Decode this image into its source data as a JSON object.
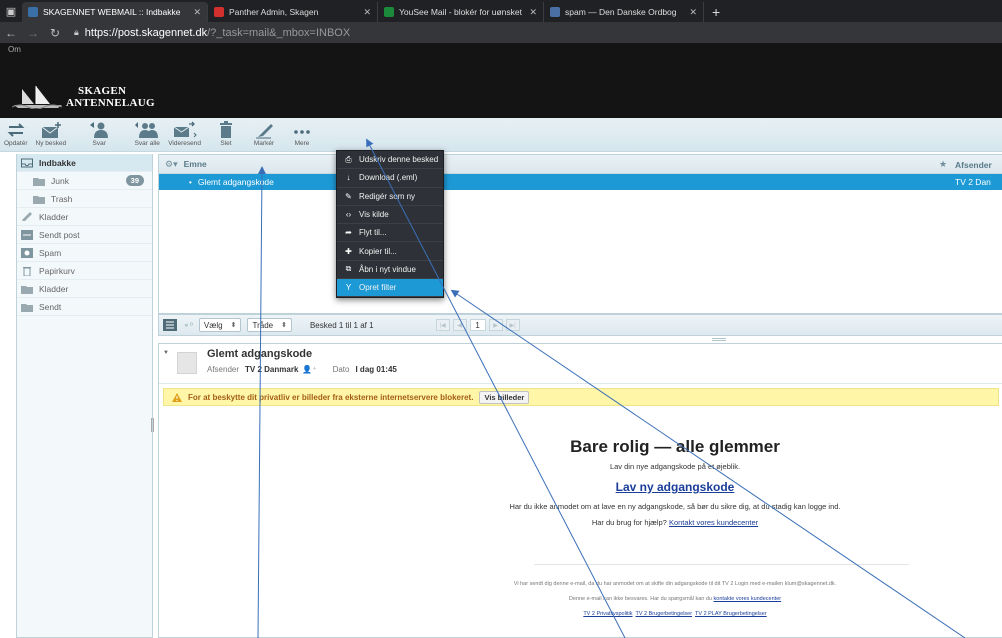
{
  "browser": {
    "tabs": [
      {
        "label": "SKAGENNET WEBMAIL :: Indbakke",
        "color": "#3b6fa8",
        "active": true
      },
      {
        "label": "Panther Admin, Skagen",
        "color": "#d32f2f",
        "active": false
      },
      {
        "label": "YouSee Mail - blokér for uønsket",
        "color": "#1b8a3a",
        "active": false
      },
      {
        "label": "spam — Den Danske Ordbog",
        "color": "#4a6fa5",
        "active": false
      }
    ],
    "url_host": "https://post.skagennet.dk",
    "url_rest": "/?_task=mail&_mbox=INBOX"
  },
  "header": {
    "about": "Om",
    "logo_line1": "SKAGEN",
    "logo_line2": "ANTENNELAUG"
  },
  "toolbar": {
    "refresh": "Opdatér",
    "compose": "Ny besked",
    "reply": "Svar",
    "reply_all": "Svar alle",
    "forward": "Videresend",
    "delete": "Slet",
    "mark": "Markér",
    "more": "Mere"
  },
  "folders": [
    {
      "label": "Indbakke",
      "icon": "inbox-icon",
      "selected": true,
      "sub": false
    },
    {
      "label": "Junk",
      "icon": "folder-icon",
      "selected": false,
      "sub": true,
      "count": "39"
    },
    {
      "label": "Trash",
      "icon": "folder-icon",
      "selected": false,
      "sub": true
    },
    {
      "label": "Kladder",
      "icon": "pencil-icon",
      "selected": false,
      "sub": false
    },
    {
      "label": "Sendt post",
      "icon": "sent-icon",
      "selected": false,
      "sub": false
    },
    {
      "label": "Spam",
      "icon": "spam-icon",
      "selected": false,
      "sub": false
    },
    {
      "label": "Papirkurv",
      "icon": "trash-icon",
      "selected": false,
      "sub": false
    },
    {
      "label": "Kladder",
      "icon": "folder-icon",
      "selected": false,
      "sub": false
    },
    {
      "label": "Sendt",
      "icon": "folder-icon",
      "selected": false,
      "sub": false
    }
  ],
  "list": {
    "col_subject": "Emne",
    "col_from": "Afsender",
    "row_subject": "Glemt adgangskode",
    "row_from": "TV 2 Dan"
  },
  "list_footer": {
    "select_label": "Vælg",
    "thread_label": "Tråde",
    "count": "Besked 1 til 1 af 1",
    "page": "1"
  },
  "menu": {
    "items": [
      {
        "label": "Udskriv denne besked",
        "icon": "print-icon",
        "glyph": "⎙"
      },
      {
        "label": "Download (.eml)",
        "icon": "download-icon",
        "glyph": "↓"
      },
      {
        "label": "Redigér som ny",
        "icon": "edit-icon",
        "glyph": "✎"
      },
      {
        "label": "Vis kilde",
        "icon": "code-icon",
        "glyph": "‹›"
      },
      {
        "label": "Flyt til...",
        "icon": "move-icon",
        "glyph": "➦"
      },
      {
        "label": "Kopier til...",
        "icon": "copy-icon",
        "glyph": "✚"
      },
      {
        "label": "Åbn i nyt vindue",
        "icon": "new-window-icon",
        "glyph": "⧉"
      },
      {
        "label": "Opret filter",
        "icon": "filter-icon",
        "glyph": "Y"
      }
    ],
    "highlighted_index": 7
  },
  "preview": {
    "subject": "Glemt adgangskode",
    "from_label": "Afsender",
    "from": "TV 2 Danmark",
    "date_label": "Dato",
    "date": "I dag 01:45",
    "remote_notice": "For at beskytte dit privatliv er billeder fra eksterne internetservere blokeret.",
    "show_images": "Vis billeder"
  },
  "email": {
    "title": "Bare rolig — alle glemmer",
    "subtitle": "Lav din nye adgangskode på et øjeblik.",
    "cta": "Lav ny adgangskode",
    "p1": "Har du ikke anmodet om at lave en ny adgangskode, så bør du sikre dig, at du stadig kan logge ind.",
    "p2_pre": "Har du brug for hjælp?",
    "p2_link": "Kontakt vores kundecenter",
    "small1": "Vi har sendt dig denne e-mail, da du har anmodet om at skifte din adgangskode til dit TV 2 Login med e-mailen klum@skagennet.dk.",
    "small2_pre": "Denne e-mail kan ikke besvares. Har du spørgsmål kan du",
    "small2_link": "kontakte vores kundecenter",
    "links": [
      "TV 2 Privatlivspolitik",
      "TV 2 Brugerbetingelser",
      "TV 2 PLAY Brugerbetingelser"
    ]
  },
  "colors": {
    "accent": "#1d9ad6",
    "menu_bg": "#2e3238",
    "warning_bg": "#fff6a8",
    "arrow": "#3a6fb8"
  }
}
